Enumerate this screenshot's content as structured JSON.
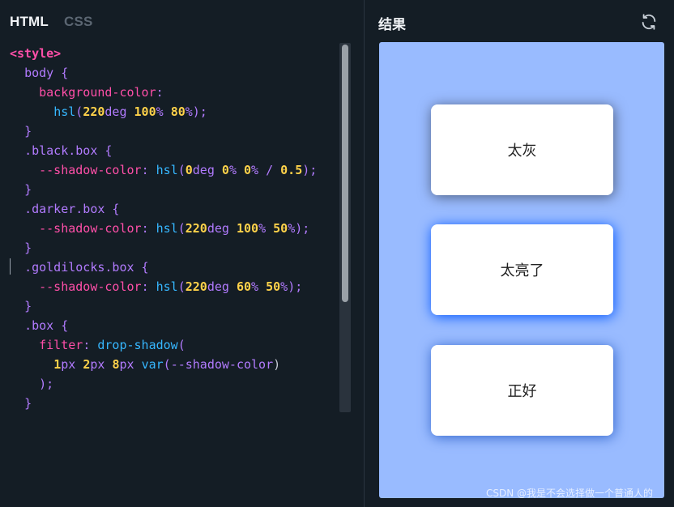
{
  "editor": {
    "tabs": [
      {
        "label": "HTML",
        "active": true
      },
      {
        "label": "CSS",
        "active": false
      }
    ],
    "code_lines": [
      "<style>",
      "  body {",
      "    background-color:",
      "      hsl(220deg 100% 80%);",
      "  }",
      "  .black.box {",
      "    --shadow-color: hsl(0deg 0% 0% / 0.5);",
      "  }",
      "  .darker.box {",
      "    --shadow-color: hsl(220deg 100% 50%);",
      "  }",
      "  .goldilocks.box {",
      "    --shadow-color: hsl(220deg 60% 50%);",
      "  }",
      "  .box {",
      "    filter: drop-shadow(",
      "      1px 2px 8px var(--shadow-color)",
      "    );",
      "  }"
    ]
  },
  "result": {
    "title": "结果",
    "refresh_icon": "refresh-icon",
    "boxes": [
      {
        "label": "太灰"
      },
      {
        "label": "太亮了"
      },
      {
        "label": "正好"
      }
    ],
    "preview_background": "#99bbff"
  },
  "watermark": "CSDN @我是不会选择做一个普通人的",
  "colors": {
    "editor_bg": "#141d25",
    "tag": "#ff4fa8",
    "selector": "#b27bff",
    "function": "#36b7ff",
    "number": "#ffd24a"
  }
}
